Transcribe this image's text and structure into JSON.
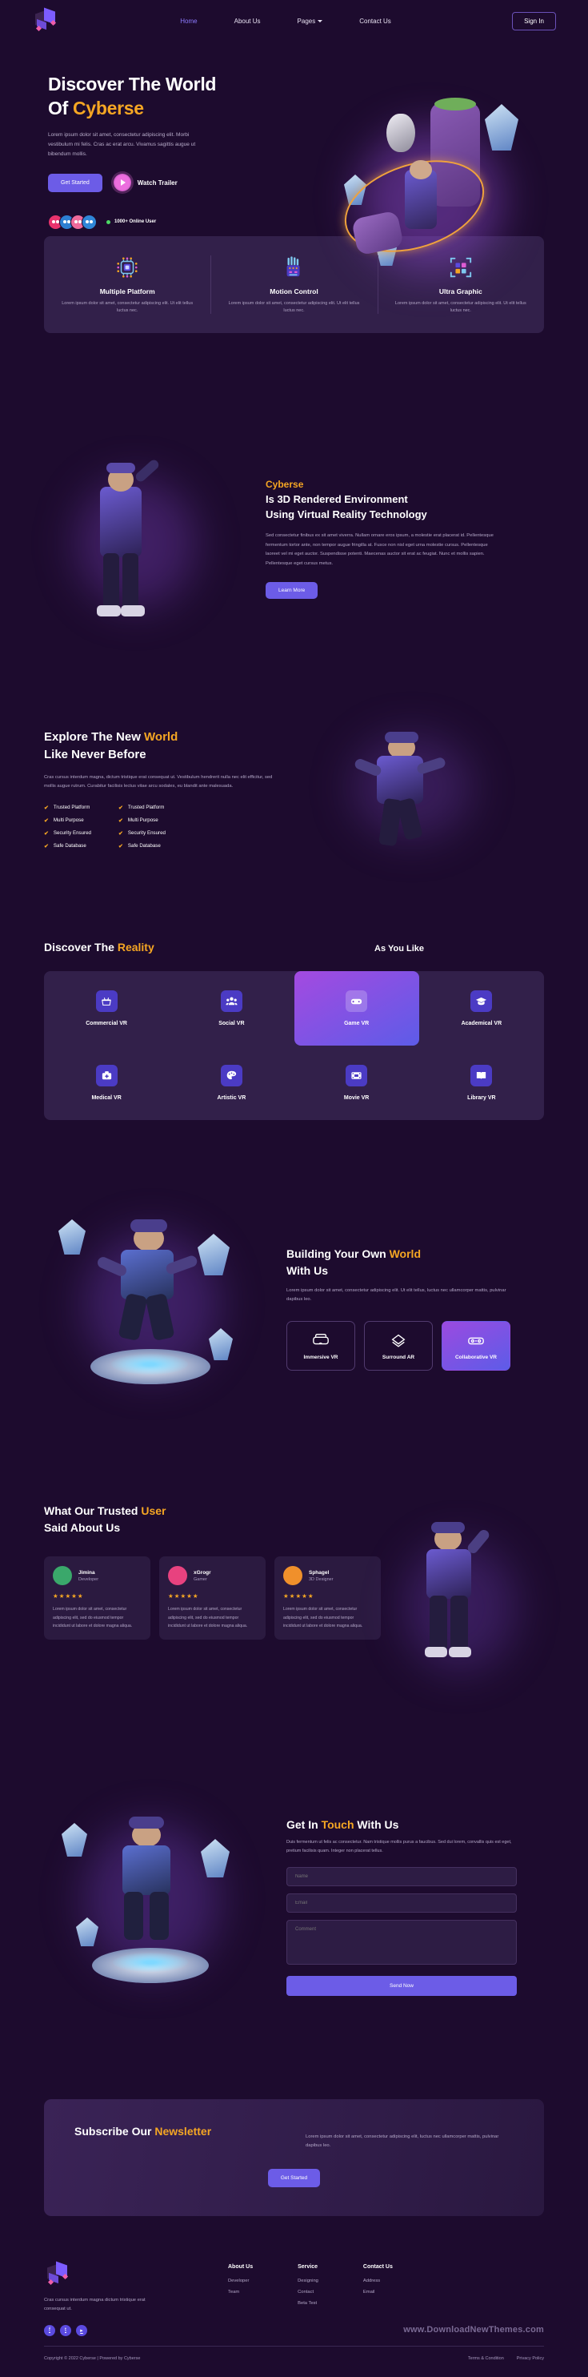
{
  "brand": {
    "name": "Cyberse",
    "logo_icon": "cube-logo-icon"
  },
  "header": {
    "nav": [
      {
        "label": "Home",
        "active": true
      },
      {
        "label": "About Us",
        "active": false
      },
      {
        "label": "Pages",
        "active": false,
        "has_dropdown": true
      },
      {
        "label": "Contact Us",
        "active": false
      }
    ],
    "signin_label": "Sign In"
  },
  "hero": {
    "title_line1": "Discover The World",
    "title_line2_prefix": "Of ",
    "title_line2_accent": "Cyberse",
    "paragraph": "Lorem ipsum dolor sit amet, consectetur adipiscing elit. Morbi vestibulum mi felis. Cras ac erat arcu. Vivamus sagittis augue ut bibendum mollis.",
    "btn_primary": "Get Started",
    "btn_watch": "Watch Trailer",
    "online_users": "1000+ Online User",
    "avatar_colors": [
      "#e8336d",
      "#2d7fd3",
      "#f06a9b",
      "#2f86d8"
    ]
  },
  "features": [
    {
      "icon": "chip-icon",
      "title": "Multiple Platform",
      "text": "Lorem ipsum dolor sit amet, consectetur adipiscing elit. Ut elit tellus luctus nec."
    },
    {
      "icon": "motion-hand-icon",
      "title": "Motion Control",
      "text": "Lorem ipsum dolor sit amet, consectetur adipiscing elit. Ut elit tellus luctus nec."
    },
    {
      "icon": "ultra-graphic-icon",
      "title": "Ultra Graphic",
      "text": "Lorem ipsum dolor sit amet, consectetur adipiscing elit. Ut elit tellus luctus nec."
    }
  ],
  "rendered_section": {
    "eyebrow": "Cyberse",
    "title_line1": "Is 3D Rendered Environment",
    "title_line2": "Using Virtual Reality Technology",
    "paragraph": "Sed consectetur finibus ex sit amet viverra. Nullam ornare eros ipsum, a molestie erat placerat id. Pellentesque fermentum tortor ante, non tempor augue fringilla at. Fusce non nisl eget urna molestie cursus. Pellentesque laoreet vel mi eget auctor. Suspendisse potenti. Maecenas auctor sit erat ac feugiat. Nunc et mollis sapien. Pellentesque eget cursus metus.",
    "button": "Learn More"
  },
  "explore": {
    "title_line1_prefix": "Explore The New ",
    "title_line1_accent": "World",
    "title_line2": "Like Never Before",
    "paragraph": "Cras cursus interdum magna, dictum tristique erat consequat ut. Vestibulum hendrerit nulla nec elit efficitur, sed mollis augue rutrum. Curabitur facilisis lectus vitae arcu sodales, eu blandit ante malesuada.",
    "checklist_left": [
      "Trusted Platform",
      "Multi Purpose",
      "Security Ensured",
      "Safe Database"
    ],
    "checklist_right": [
      "Trusted Platform",
      "Multi Purpose",
      "Security Ensured",
      "Safe Database"
    ]
  },
  "reality": {
    "title_prefix": "Discover The ",
    "title_accent": "Reality",
    "subtitle": "As You Like",
    "tiles": [
      {
        "label": "Commercial VR",
        "icon": "basket-icon",
        "active": false
      },
      {
        "label": "Social VR",
        "icon": "people-icon",
        "active": false
      },
      {
        "label": "Game VR",
        "icon": "gamepad-icon",
        "active": true
      },
      {
        "label": "Academical VR",
        "icon": "graduation-icon",
        "active": false
      },
      {
        "label": "Medical VR",
        "icon": "medical-icon",
        "active": false
      },
      {
        "label": "Artistic VR",
        "icon": "palette-icon",
        "active": false
      },
      {
        "label": "Movie VR",
        "icon": "film-icon",
        "active": false
      },
      {
        "label": "Library VR",
        "icon": "book-icon",
        "active": false
      }
    ]
  },
  "building": {
    "title_line1_prefix": "Building Your Own ",
    "title_line1_accent": "World",
    "title_line2": "With Us",
    "paragraph": "Lorem ipsum dolor sit amet, consectetur adipiscing elit. Ut elit tellus, luctus nec ullamcorper mattis, pulvinar dapibus leo.",
    "cards": [
      {
        "label": "Immersive VR",
        "icon": "vr-headset-icon",
        "active": false
      },
      {
        "label": "Surround AR",
        "icon": "surround-icon",
        "active": false
      },
      {
        "label": "Collaborative VR",
        "icon": "collab-icon",
        "active": true
      }
    ]
  },
  "testimonials": {
    "title_prefix": "What Our Trusted ",
    "title_accent": "User",
    "title_line2": "Said About Us",
    "cards": [
      {
        "name": "Jimina",
        "role": "Developer",
        "stars": "★★★★★",
        "text": "Lorem ipsum dolor sit amet, consectetur adipiscing elit, sed do eiusmod tempor incididunt ut labore et dolore magna aliqua.",
        "avatar_color": "#3aa86b"
      },
      {
        "name": "xGrogr",
        "role": "Gamer",
        "stars": "★★★★★",
        "text": "Lorem ipsum dolor sit amet, consectetur adipiscing elit, sed do eiusmod tempor incididunt ut labore et dolore magna aliqua.",
        "avatar_color": "#e8427f"
      },
      {
        "name": "Sphagel",
        "role": "3D Designer",
        "stars": "★★★★★",
        "text": "Lorem ipsum dolor sit amet, consectetur adipiscing elit, sed do eiusmod tempor incididunt ut labore et dolore magna aliqua.",
        "avatar_color": "#f0902b"
      }
    ]
  },
  "contact": {
    "title_prefix": "Get In ",
    "title_accent": "Touch",
    "title_suffix": " With Us",
    "paragraph": "Duis fermentum ut felis ac consectetur. Nam tristique mollis purus a faucibus. Sed dui lorem, convallis quis est eget, pretium facilisis quam. Integer non placerat tellus.",
    "name_placeholder": "Name",
    "email_placeholder": "Email",
    "comment_placeholder": "Comment",
    "send_label": "Send Now"
  },
  "newsletter": {
    "title_prefix": "Subscribe Our ",
    "title_accent": "Newsletter",
    "paragraph": "Lorem ipsum dolor sit amet, consectetur adipiscing elit, luctus nec ullamcorper mattis, pulvinar dapibus leo.",
    "button": "Get Started"
  },
  "footer": {
    "tagline": "Cras cursus interdum magna dictum tristique erat consequat ut.",
    "socials": [
      "facebook-icon",
      "twitter-icon",
      "youtube-icon"
    ],
    "columns": [
      {
        "title": "About Us",
        "links": [
          "Developer",
          "Team"
        ]
      },
      {
        "title": "Service",
        "links": [
          "Designing",
          "Contact",
          "Beta Test"
        ]
      },
      {
        "title": "Contact Us",
        "links": [
          "Address",
          "Email"
        ]
      }
    ],
    "watermark": "www.DownloadNewThemes.com",
    "copyright": "Copyright © 2022 Cyberse | Powered by Cyberse",
    "bottom_links": [
      "Terms & Condition",
      "Privacy Policy"
    ]
  },
  "colors": {
    "accent": "#f5a623",
    "primary": "#6c5ce7",
    "bg": "#1d0b2e",
    "card": "#32204a"
  }
}
